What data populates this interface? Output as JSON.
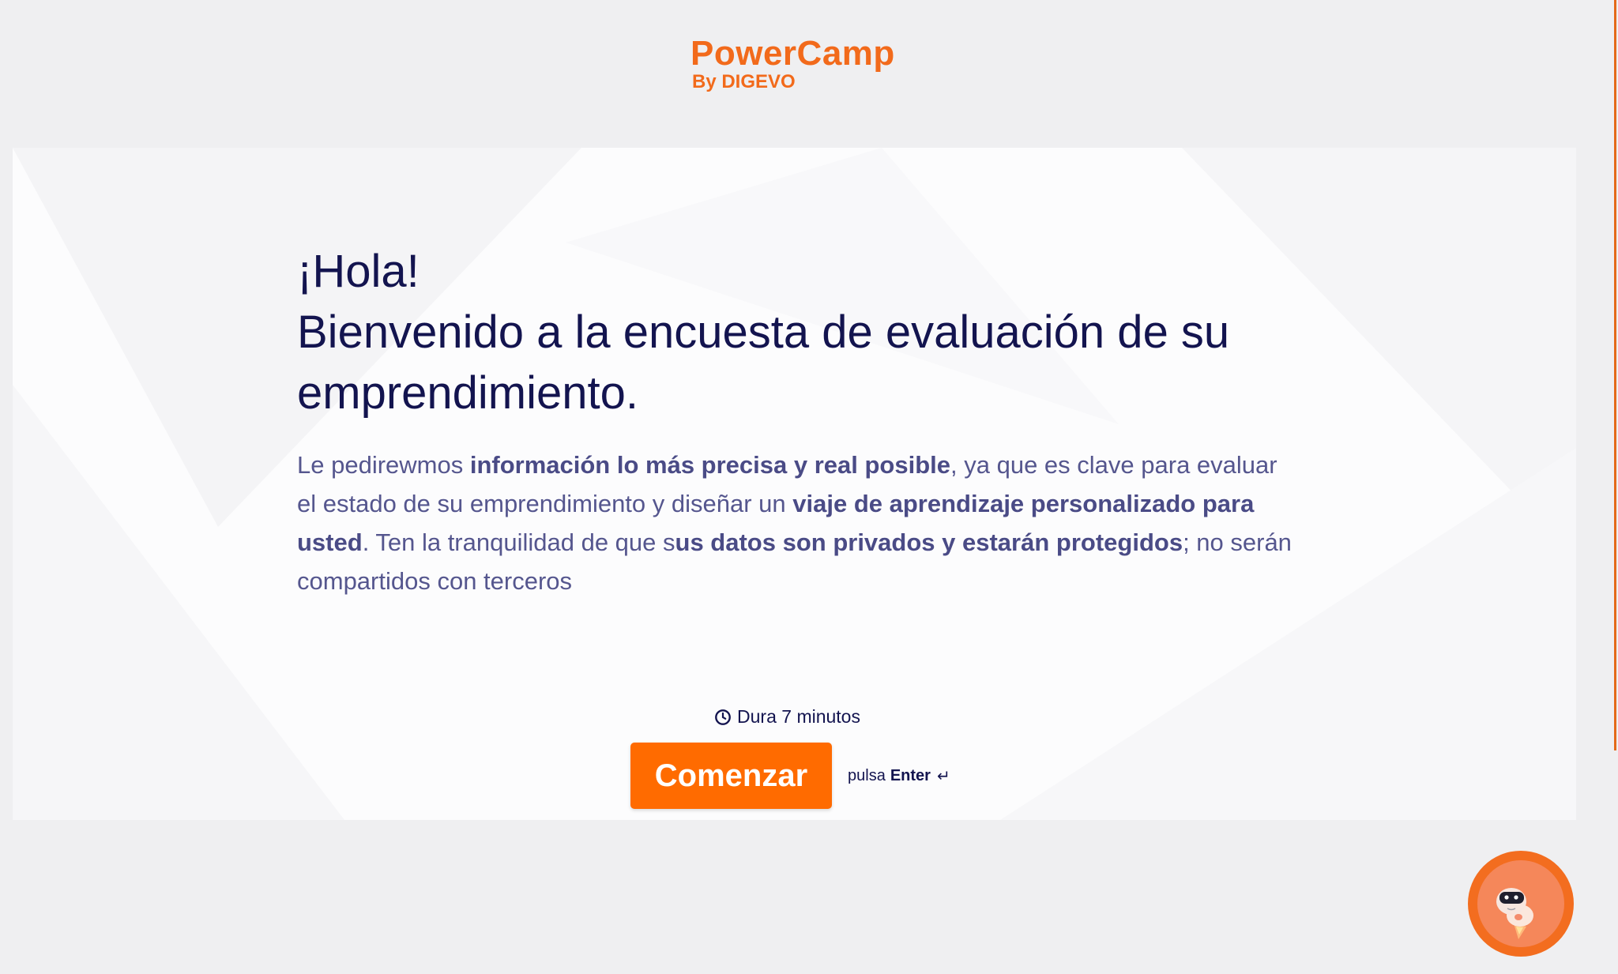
{
  "logo": {
    "name": "PowerCamp",
    "byline": "By DIGEVO"
  },
  "intro": {
    "greeting": "¡Hola!",
    "title": "Bienvenido a la encuesta de evaluación de su emprendimiento.",
    "p1": "Le pedirewmos ",
    "b1": "información lo más precisa y real posible",
    "p2": ", ya que es clave para evaluar el estado de su emprendimiento y diseñar un ",
    "b2": "viaje de aprendizaje personalizado para usted",
    "p3": ". Ten la tranquilidad de que s",
    "b3": "us datos son privados y estarán protegidos",
    "p4": "; no serán compartidos con terceros"
  },
  "duration": {
    "text": "Dura 7 minutos",
    "icon": "clock-icon"
  },
  "start": {
    "label": "Comenzar",
    "hint_prefix": "pulsa",
    "hint_key": "Enter",
    "hint_symbol": "↵"
  },
  "chat": {
    "icon": "robot-assistant-icon"
  },
  "colors": {
    "brand": "#f26a1b",
    "button": "#ff6b00",
    "heading": "#13144f",
    "body": "#55568e",
    "background": "#efeff1"
  }
}
